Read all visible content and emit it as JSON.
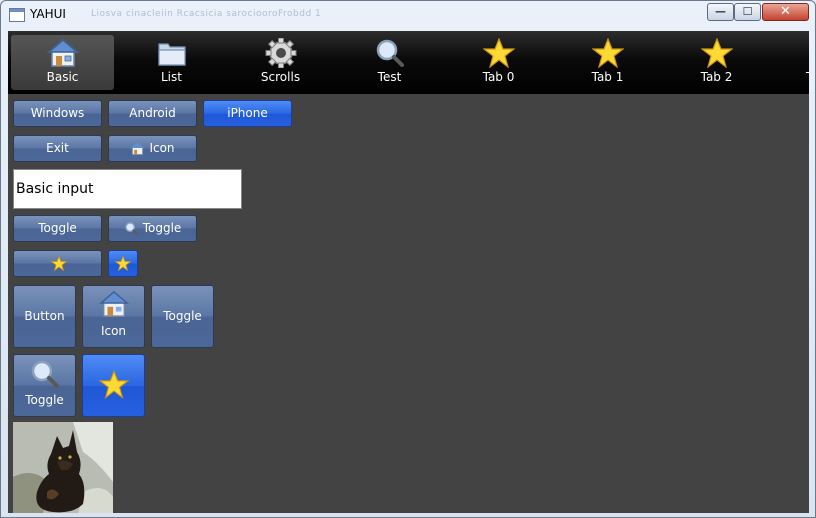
{
  "window": {
    "title": "YAHUI",
    "ghost_title": "Liosva cinacleiin Rcacsicia sarociooroFrobdd 1",
    "controls": {
      "minimize": "—",
      "maximize": "☐",
      "close": "✕"
    }
  },
  "tabs": [
    {
      "label": "Basic",
      "icon": "home-icon",
      "active": true
    },
    {
      "label": "List",
      "icon": "folder-icon",
      "active": false
    },
    {
      "label": "Scrolls",
      "icon": "gear-icon",
      "active": false
    },
    {
      "label": "Test",
      "icon": "magnifier-icon",
      "active": false
    },
    {
      "label": "Tab 0",
      "icon": "star-icon",
      "active": false
    },
    {
      "label": "Tab 1",
      "icon": "star-icon",
      "active": false
    },
    {
      "label": "Tab 2",
      "icon": "star-icon",
      "active": false
    },
    {
      "label": "T",
      "icon": "",
      "active": false
    }
  ],
  "buttons": {
    "windows": "Windows",
    "android": "Android",
    "iphone": "iPhone",
    "exit": "Exit",
    "icon": "Icon",
    "toggle": "Toggle",
    "toggle_search": "Toggle",
    "big_button": "Button",
    "big_icon": "Icon",
    "big_toggle": "Toggle",
    "big_search_toggle": "Toggle"
  },
  "input": {
    "value": "Basic input"
  },
  "colors": {
    "accent": "#2a67e2",
    "button": "#5b76a5",
    "background": "#434343",
    "tabbar": "#000000"
  }
}
